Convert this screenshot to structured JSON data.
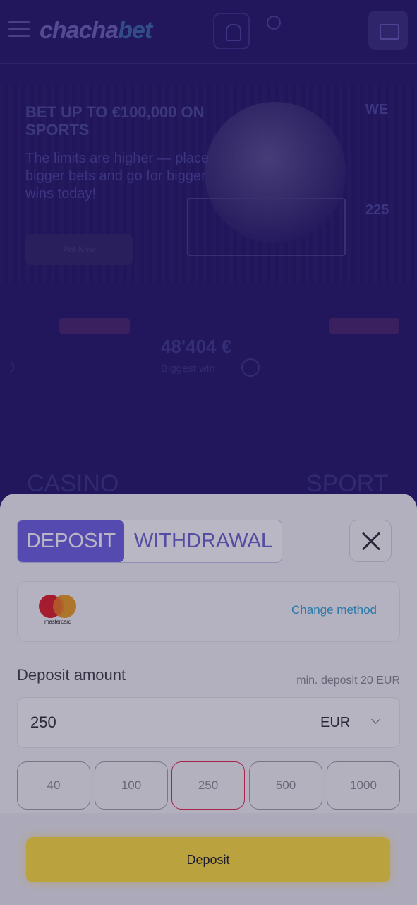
{
  "background": {
    "logo": {
      "part1": "chacha",
      "part2": "bet"
    },
    "promo": {
      "title": "BET UP TO €100,000 ON SPORTS",
      "text": "The limits are higher — place bigger bets and go for bigger wins today!",
      "button": "Bet Now",
      "right_top": "WE",
      "right_bottom": "225"
    },
    "win": {
      "amount": "48'404 €",
      "label": "Biggest win"
    },
    "categories": [
      "CASINO",
      "SPORT"
    ]
  },
  "sheet": {
    "tabs": [
      {
        "label": "DEPOSIT",
        "active": true
      },
      {
        "label": "WITHDRAWAL",
        "active": false
      }
    ],
    "close_icon": "close-icon",
    "method": {
      "brand": "mastercard",
      "change_label": "Change method"
    },
    "amount_label": "Deposit amount",
    "min_note": "min. deposit 20 EUR",
    "amount_value": "250",
    "currency": "EUR",
    "presets": [
      "40",
      "100",
      "250",
      "500",
      "1000"
    ],
    "selected_preset": "250",
    "submit_label": "Deposit",
    "colors": {
      "accent": "#6b5fe2",
      "submit": "#ffe03a",
      "selected_border": "#e3264e",
      "link": "#29a6d9"
    }
  }
}
